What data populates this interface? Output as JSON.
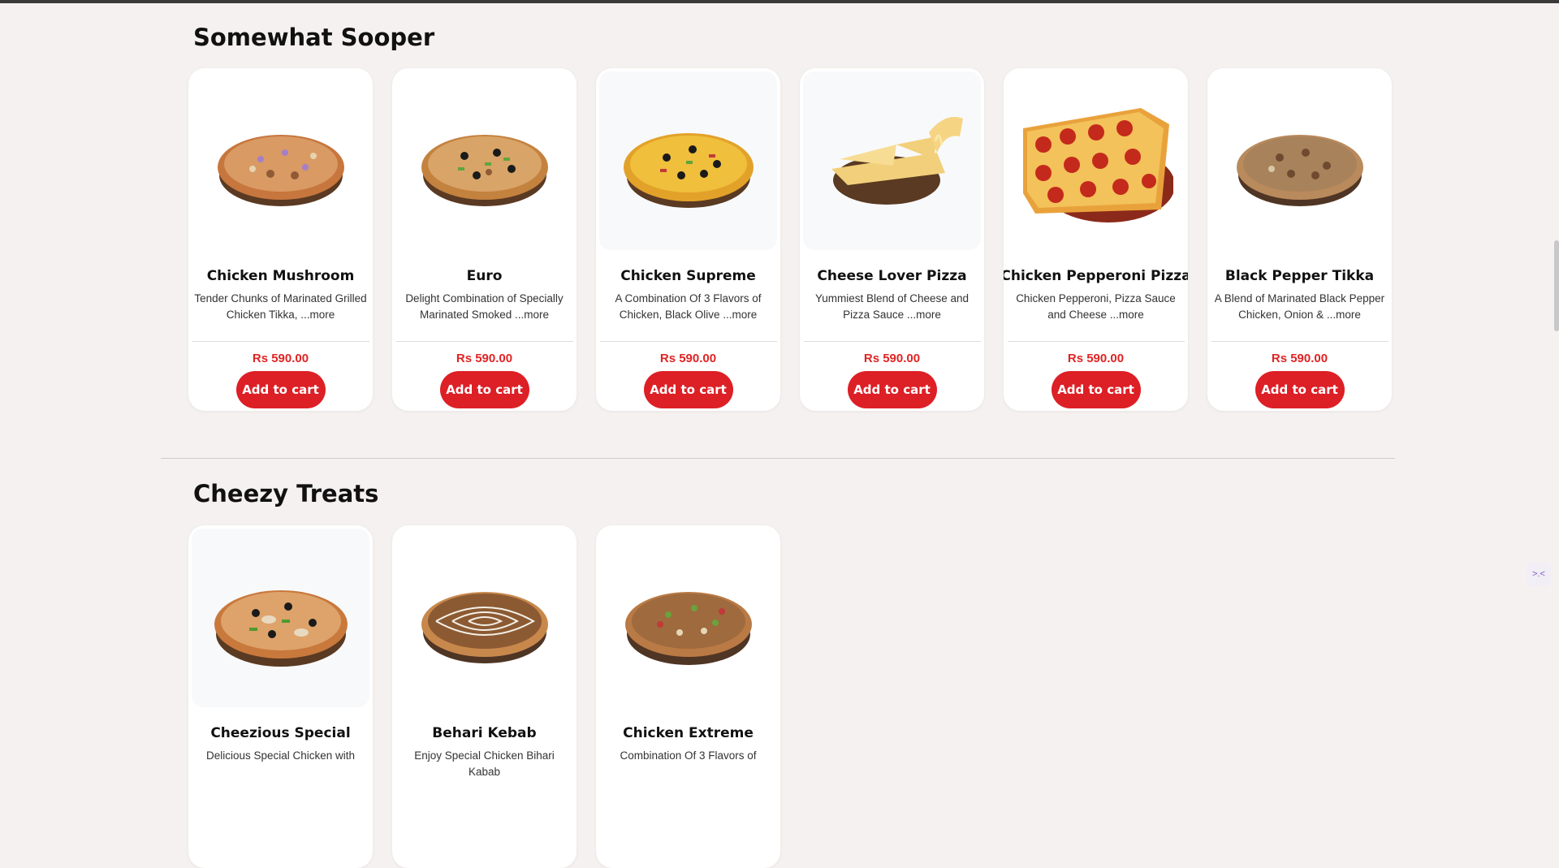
{
  "sections": [
    {
      "title": "Somewhat Sooper",
      "items": [
        {
          "name": "Chicken Mushroom",
          "desc": "Tender Chunks of Marinated Grilled Chicken Tikka, ",
          "more": "...more",
          "price": "Rs 590.00",
          "button": "Add to cart"
        },
        {
          "name": "Euro",
          "desc": "Delight Combination of Specially Marinated Smoked ",
          "more": "...more",
          "price": "Rs 590.00",
          "button": "Add to cart"
        },
        {
          "name": "Chicken Supreme",
          "desc": "A Combination Of 3 Flavors of Chicken, Black Olive ",
          "more": "...more",
          "price": "Rs 590.00",
          "button": "Add to cart"
        },
        {
          "name": "Cheese Lover Pizza",
          "desc": "Yummiest Blend of Cheese and Pizza Sauce ",
          "more": "...more",
          "price": "Rs 590.00",
          "button": "Add to cart"
        },
        {
          "name": "Chicken Pepperoni Pizza",
          "desc": "Chicken Pepperoni, Pizza Sauce and Cheese ",
          "more": "...more",
          "price": "Rs 590.00",
          "button": "Add to cart"
        },
        {
          "name": "Black Pepper Tikka",
          "desc": "A Blend of Marinated Black Pepper Chicken, Onion & ",
          "more": "...more",
          "price": "Rs 590.00",
          "button": "Add to cart"
        }
      ]
    },
    {
      "title": "Cheezy Treats",
      "items": [
        {
          "name": "Cheezious Special",
          "desc": "Delicious Special Chicken with",
          "more": "",
          "price": "",
          "button": ""
        },
        {
          "name": "Behari Kebab",
          "desc": "Enjoy Special Chicken Bihari Kabab",
          "more": "",
          "price": "",
          "button": ""
        },
        {
          "name": "Chicken Extreme",
          "desc": "Combination Of 3 Flavors of",
          "more": "",
          "price": "",
          "button": ""
        }
      ]
    }
  ],
  "widget": {
    "icon": "chat-bot-icon",
    "glyph": ">.<"
  },
  "colors": {
    "accent": "#dd1f26",
    "price": "#e02424",
    "background": "#f5f1f0"
  }
}
